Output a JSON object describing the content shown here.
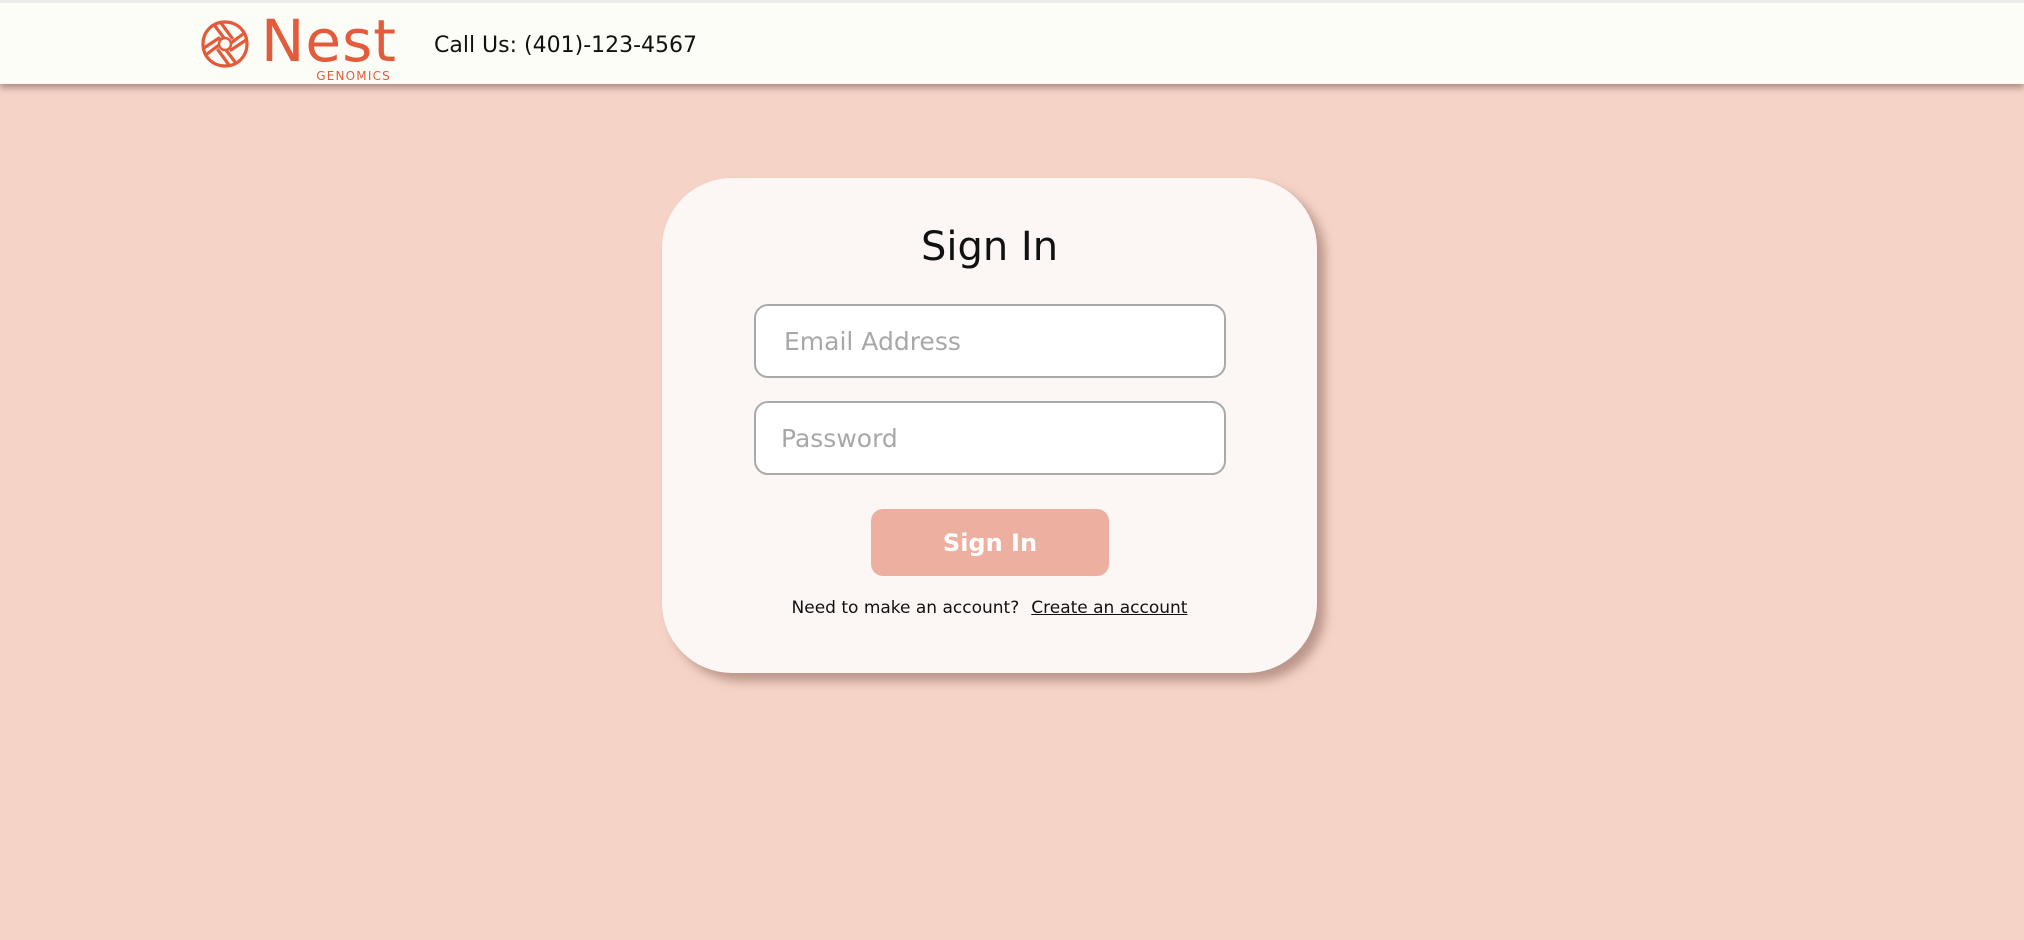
{
  "header": {
    "brand_name": "Nest",
    "brand_sub": "GENOMICS",
    "call_text": "Call Us: (401)-123-4567"
  },
  "signin": {
    "title": "Sign In",
    "email_placeholder": "Email Address",
    "password_placeholder": "Password",
    "button_label": "Sign In",
    "prompt_text": "Need to make an account?",
    "create_link": "Create an account"
  },
  "colors": {
    "page_bg": "#f5d3c7",
    "header_bg": "#fdfdf7",
    "brand": "#e35b3b",
    "button_bg": "#edb0a0",
    "card_bg": "#fcf6f4"
  },
  "icons": {
    "logo_mark": "spiral-logo-icon"
  }
}
